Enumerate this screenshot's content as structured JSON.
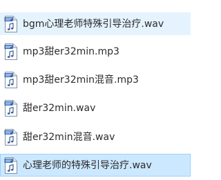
{
  "files": [
    {
      "name": "bgm心理老师特殊引导治疗.wav",
      "icon": "audio-file-icon",
      "state": "hover"
    },
    {
      "name": "mp3甜er32min.mp3",
      "icon": "audio-file-icon",
      "state": "normal"
    },
    {
      "name": "mp3甜er32min混音.mp3",
      "icon": "audio-file-icon",
      "state": "normal"
    },
    {
      "name": "甜er32min.wav",
      "icon": "audio-file-icon",
      "state": "normal"
    },
    {
      "name": "甜er32min混音.wav",
      "icon": "audio-file-icon",
      "state": "normal"
    },
    {
      "name": "心理老师的特殊引导治疗.wav",
      "icon": "audio-file-icon",
      "state": "selected"
    }
  ],
  "colors": {
    "selected_bg": "#cce8ff",
    "selected_border": "#99d1ff",
    "hover_bg": "#e5f3ff",
    "icon_badge": "#2f66b8",
    "text": "#2b2b2b"
  }
}
